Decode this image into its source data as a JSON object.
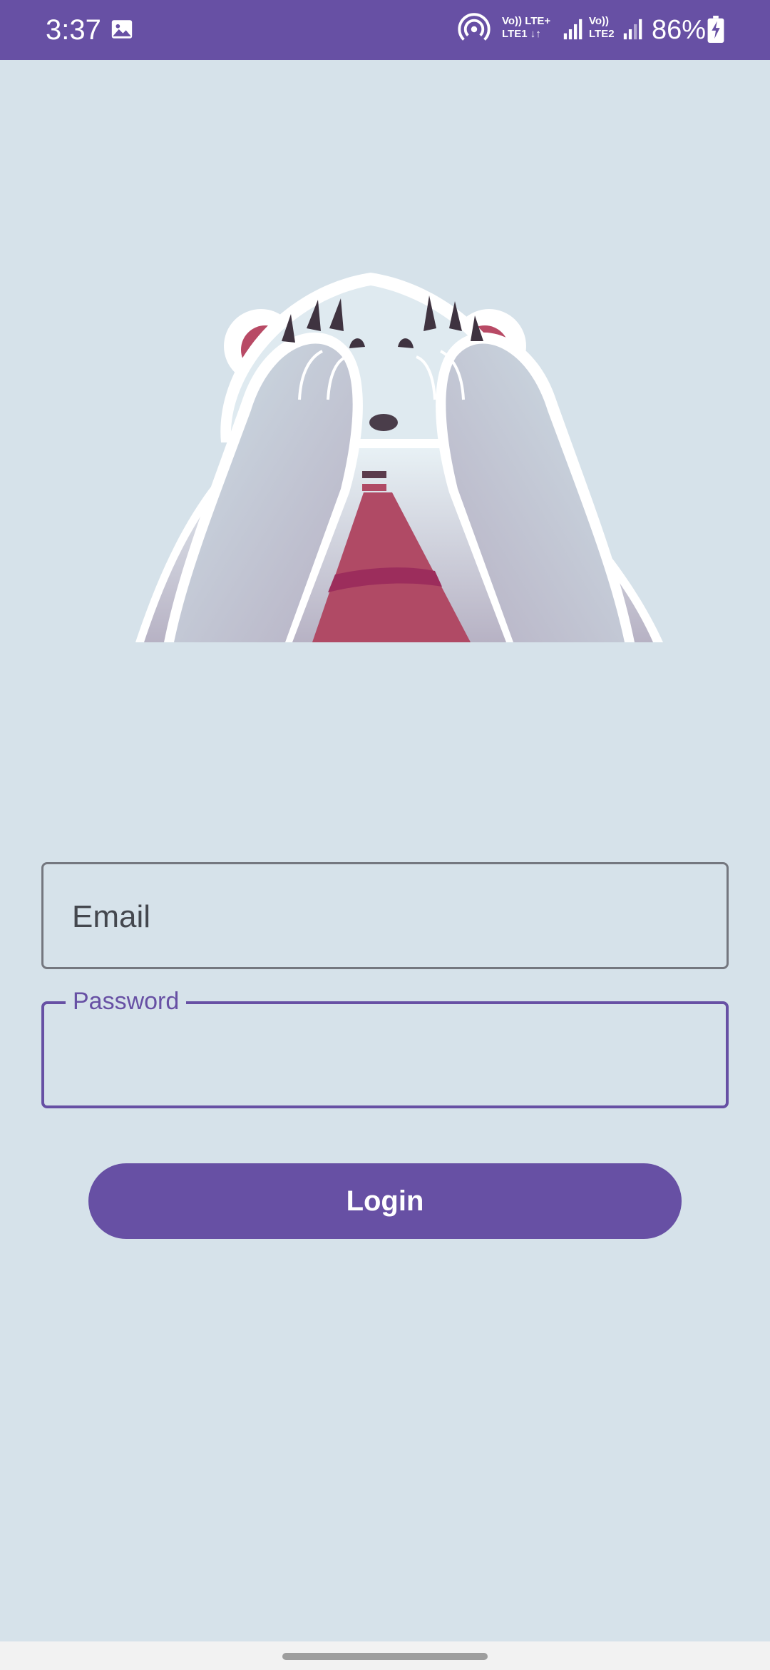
{
  "status_bar": {
    "time": "3:37",
    "net1_top": "Vo)) LTE+",
    "net1_bottom": "LTE1 ↓↑",
    "net2_top": "Vo))",
    "net2_bottom": "LTE2",
    "battery_percent": "86%",
    "icons": [
      "gallery-icon",
      "hotspot-icon",
      "signal-icon",
      "battery-charging-icon"
    ]
  },
  "illustration": {
    "icon": "bear-covering-eyes-illustration"
  },
  "form": {
    "email_placeholder": "Email",
    "password_label": "Password",
    "login_label": "Login"
  },
  "colors": {
    "primary": "#6750a4",
    "background": "#d6e2ea",
    "outline": "#74777f"
  }
}
